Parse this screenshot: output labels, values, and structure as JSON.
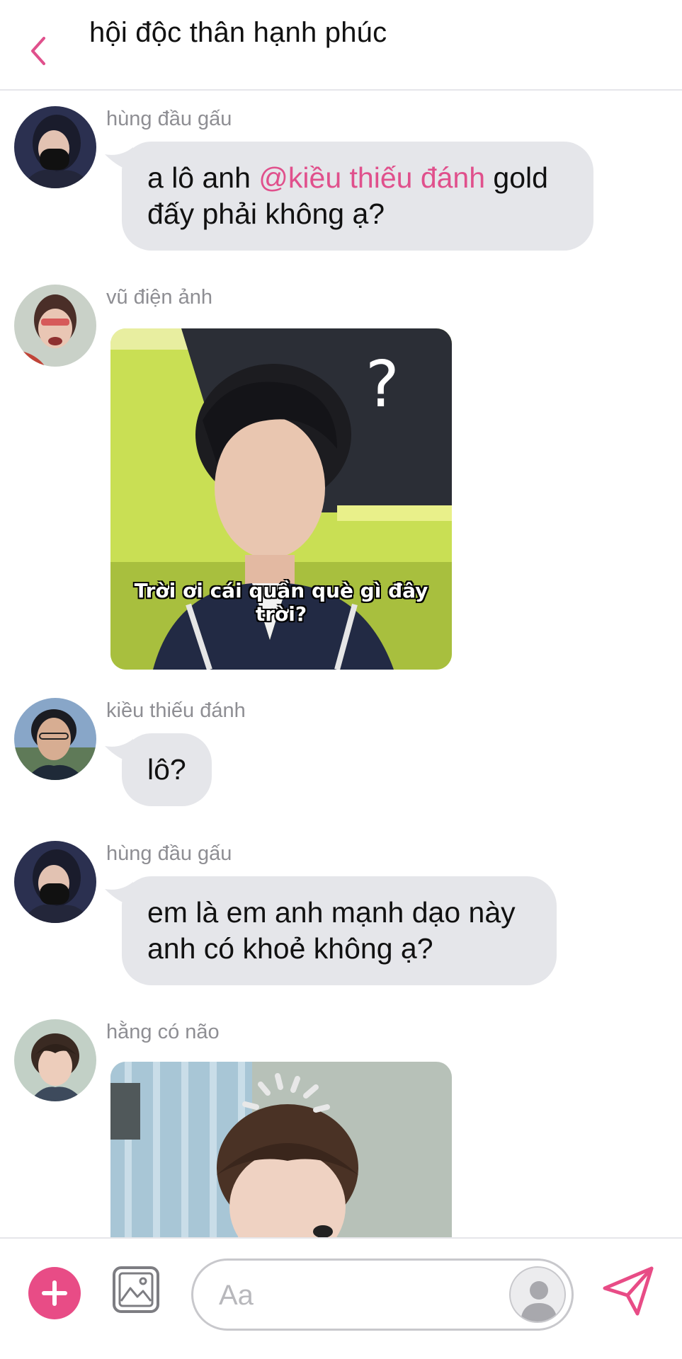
{
  "header": {
    "title": "hội độc thân hạnh phúc",
    "accent_color": "#e0508c"
  },
  "messages": [
    {
      "sender": "hùng đầu gấu",
      "text_before": "a lô anh ",
      "mention": "@kiều thiếu đánh",
      "text_after": " gold đấy phải không ạ?"
    },
    {
      "sender": "vũ điện ảnh",
      "image_caption": "Trời ơi cái quần què gì đây trời?"
    },
    {
      "sender": "kiều thiếu đánh",
      "text": "lô?"
    },
    {
      "sender": "hùng đầu gấu",
      "text": "em là em anh mạnh dạo này anh có khoẻ không ạ?"
    },
    {
      "sender": "hằng có não"
    }
  ],
  "composer": {
    "placeholder": "Aa",
    "add_icon": "plus-icon",
    "image_icon": "image-icon",
    "send_icon": "send-icon",
    "accent_color": "#e84c86"
  }
}
